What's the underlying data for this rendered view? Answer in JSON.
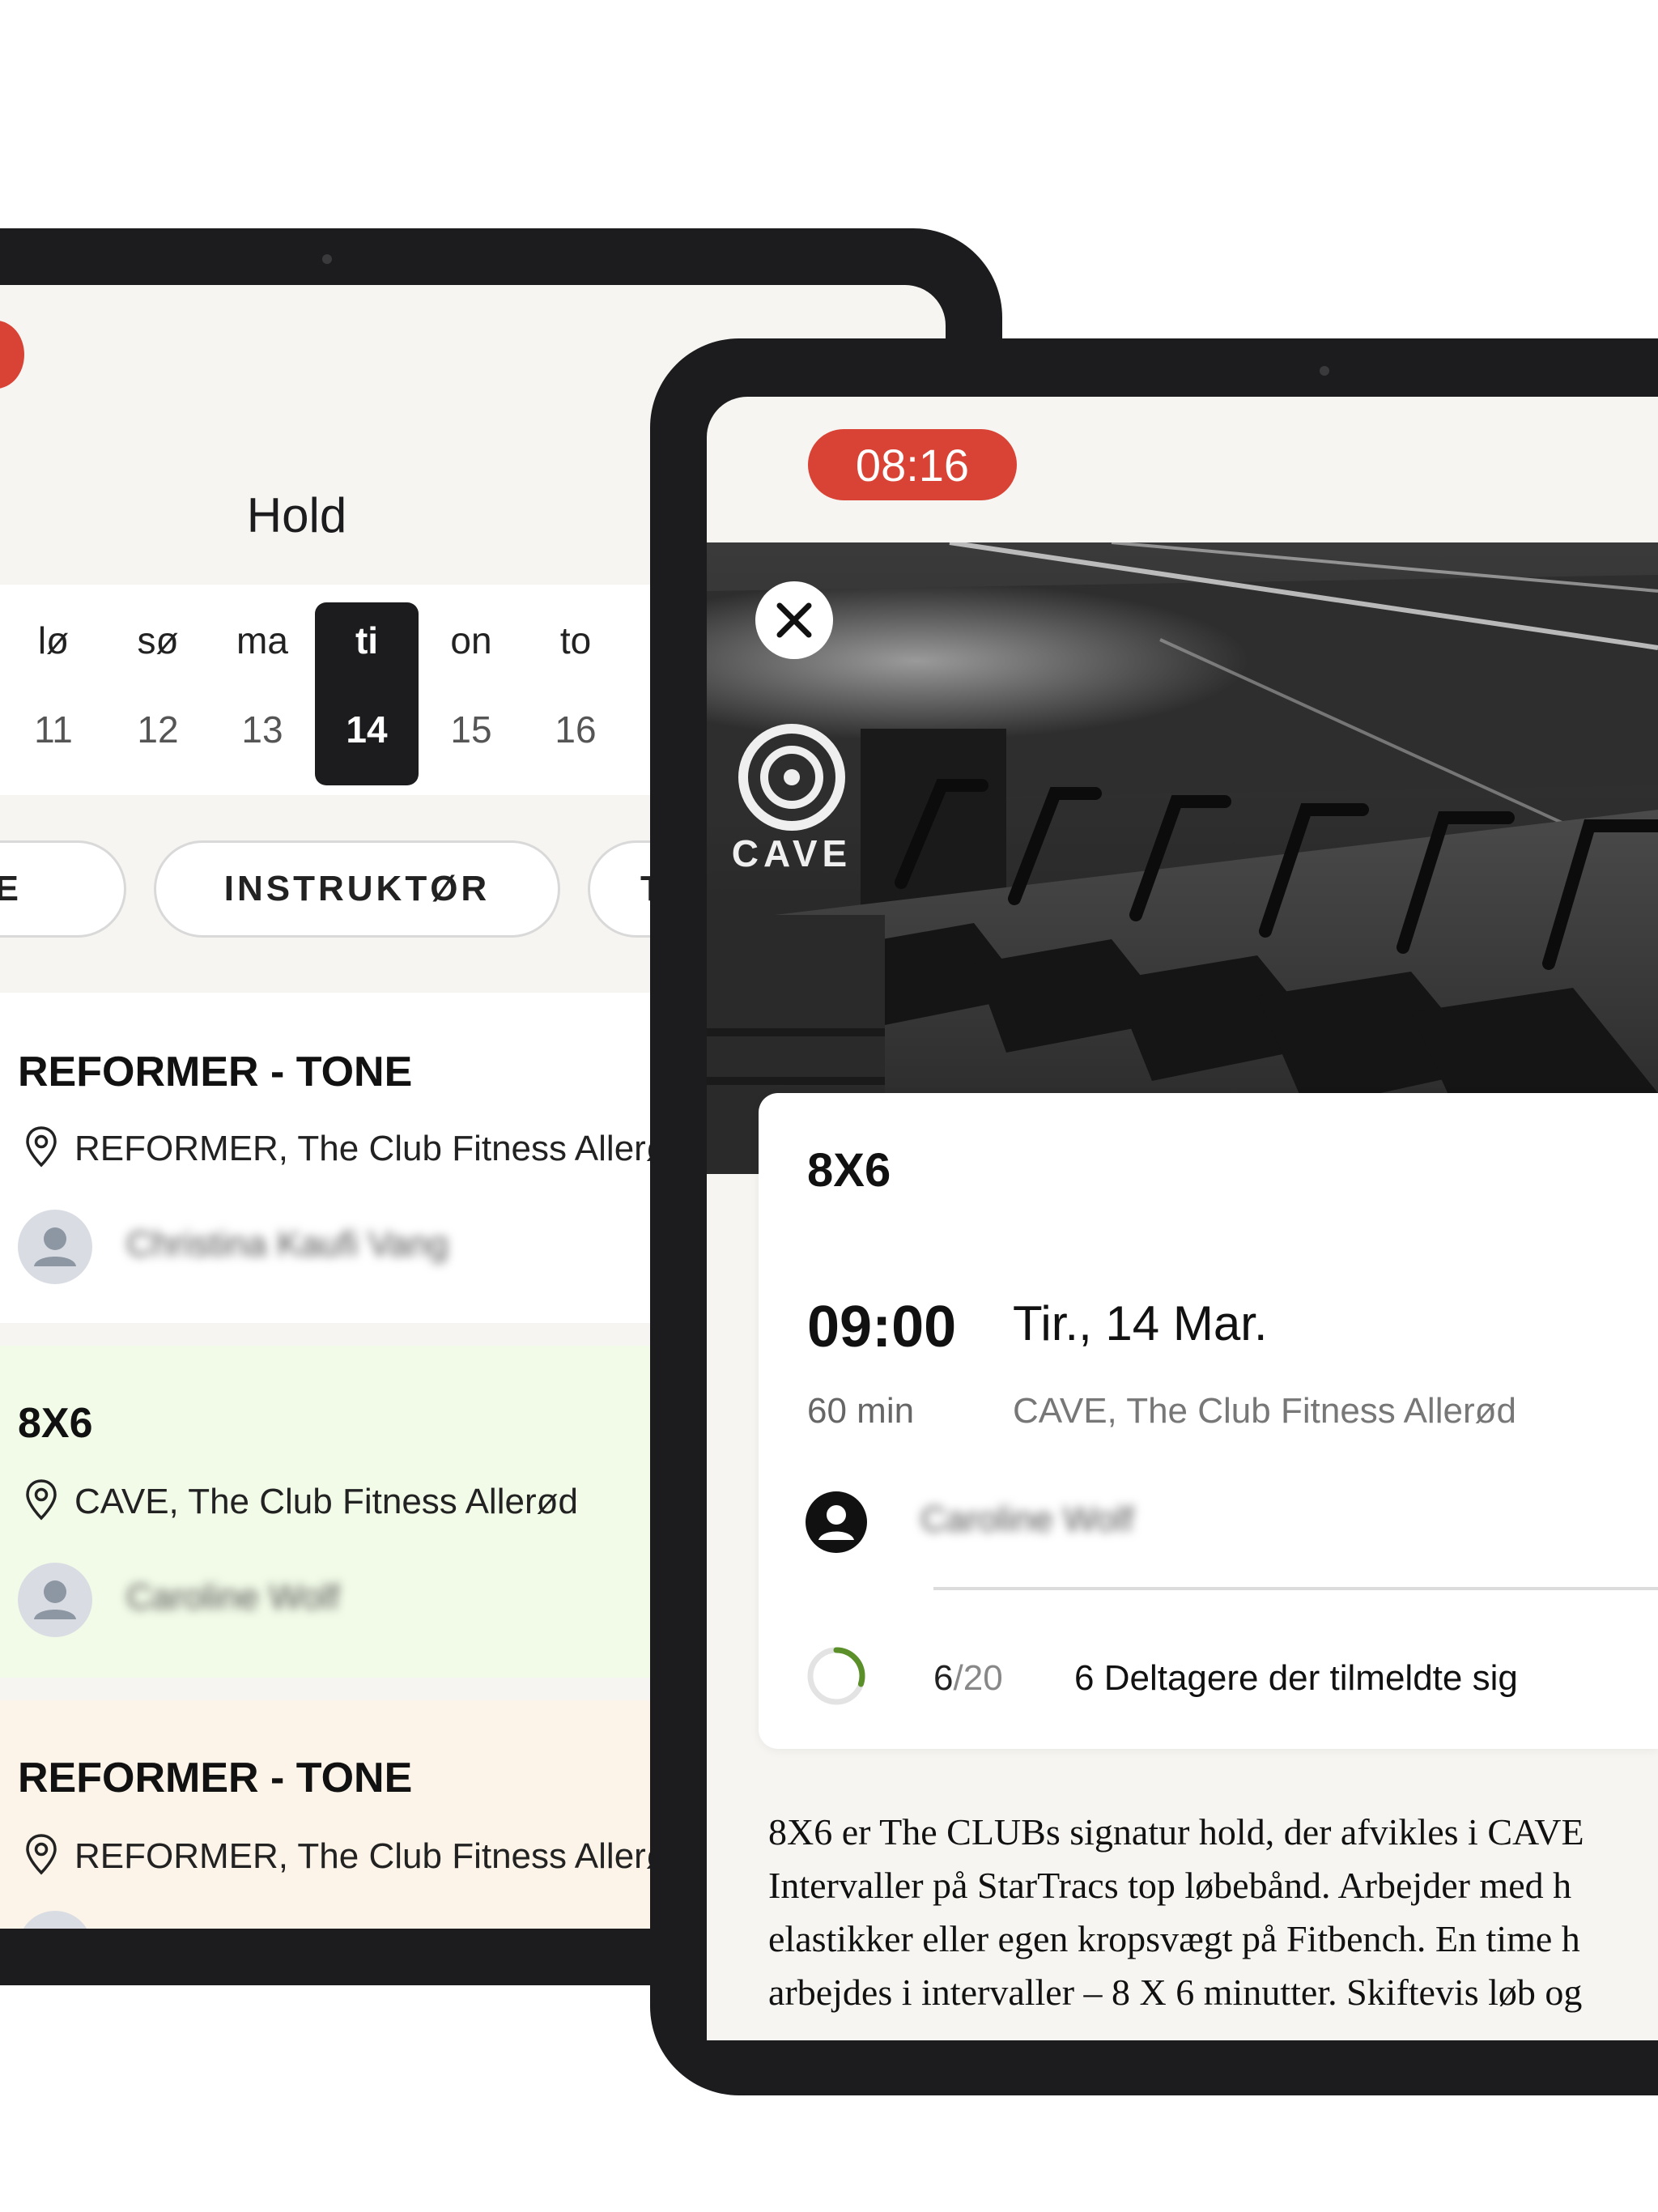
{
  "colors": {
    "accent_red": "#d94336",
    "bezel": "#1c1c1e",
    "screen_bg": "#f6f5f1",
    "selected_day": "#1c1c1e",
    "progress": "#5a8f29"
  },
  "back_tablet": {
    "title": "Hold",
    "week": [
      {
        "day": "lø",
        "num": "11",
        "selected": false
      },
      {
        "day": "sø",
        "num": "12",
        "selected": false
      },
      {
        "day": "ma",
        "num": "13",
        "selected": false
      },
      {
        "day": "ti",
        "num": "14",
        "selected": true
      },
      {
        "day": "on",
        "num": "15",
        "selected": false
      },
      {
        "day": "to",
        "num": "16",
        "selected": false
      }
    ],
    "filters": [
      "E",
      "INSTRUKTØR",
      "T"
    ],
    "classes": [
      {
        "title": "REFORMER - TONE",
        "location": "REFORMER, The Club Fitness Allerød",
        "instructor": "Christina Kaufi Vang",
        "bg": "#ffffff"
      },
      {
        "title": "8X6",
        "location": "CAVE, The Club Fitness Allerød",
        "instructor": "Caroline Wolf",
        "bg": "#f2fbe8"
      },
      {
        "title": "REFORMER - TONE",
        "location": "REFORMER, The Club Fitness Allerød",
        "instructor": "",
        "bg": "#fcf4e8"
      }
    ]
  },
  "front_tablet": {
    "clock": "08:16",
    "hero_logo_text": "CAVE",
    "class_name": "8X6",
    "time": "09:00",
    "date": "Tir., 14 Mar.",
    "duration": "60 min",
    "place": "CAVE, The Club Fitness Allerød",
    "instructor": "Caroline Wolf",
    "participants": {
      "count": "6",
      "capacity": "20",
      "fraction": 0.3,
      "label": "6 Deltagere der tilmeldte sig"
    },
    "description": [
      "8X6 er The CLUBs signatur hold, der afvikles i CAVE",
      "Intervaller på StarTracs top løbebånd. Arbejder med h",
      "elastikker eller egen kropsvægt på Fitbench. En time h",
      "arbejdes i intervaller – 8 X 6 minutter. Skiftevis løb og"
    ]
  }
}
